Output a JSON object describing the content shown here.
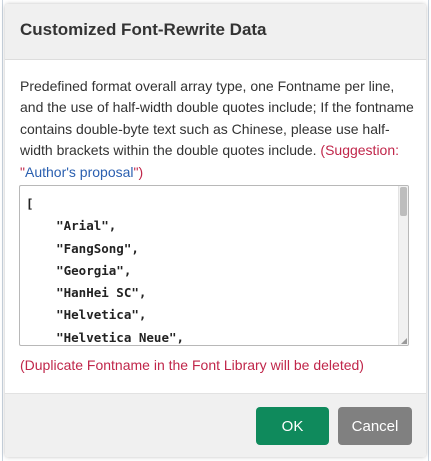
{
  "dialog": {
    "title": "Customized Font-Rewrite Data",
    "description": "Predefined format overall array type, one Fontname per line, and the use of half-width double quotes include; If the fontname contains double-byte text such as Chinese, please use half-width brackets within the double quotes include.",
    "suggestion_prefix": "(Suggestion: \"",
    "suggestion_value": "Author's proposal",
    "suggestion_suffix": "\")",
    "editor_text": "[\n    \"Arial\",\n    \"FangSong\",\n    \"Georgia\",\n    \"HanHei SC\",\n    \"Helvetica\",\n    \"Helvetica Neue\",",
    "warning": "(Duplicate Fontname in the Font Library will be deleted)",
    "ok_label": "OK",
    "cancel_label": "Cancel"
  },
  "colors": {
    "ok_button": "#0f8a5c",
    "cancel_button": "#808080",
    "warning_text": "#c0264a",
    "link_text": "#2a5fb0"
  }
}
